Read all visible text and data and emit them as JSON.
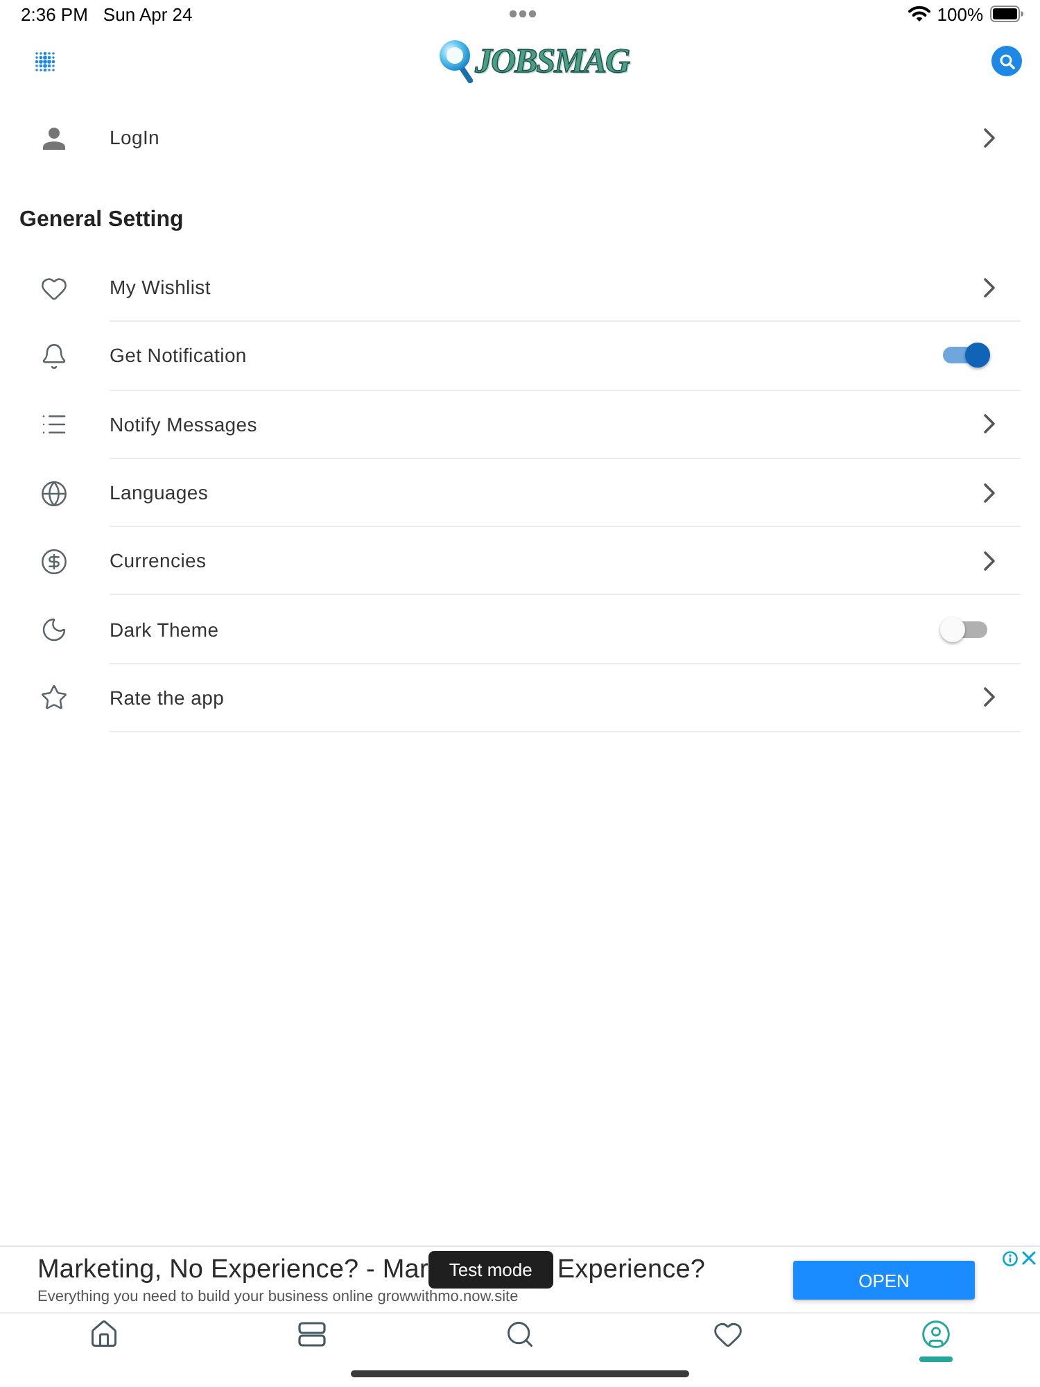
{
  "status_bar": {
    "time": "2:36 PM",
    "date": "Sun Apr 24",
    "battery": "100%"
  },
  "header": {
    "logo": "JOBSMAG"
  },
  "account": {
    "label": "LogIn"
  },
  "section": {
    "title": "General Setting"
  },
  "settings": [
    {
      "kind": "link",
      "label": "My Wishlist"
    },
    {
      "kind": "toggle",
      "label": "Get Notification",
      "on": true
    },
    {
      "kind": "link",
      "label": "Notify Messages"
    },
    {
      "kind": "link",
      "label": "Languages"
    },
    {
      "kind": "link",
      "label": "Currencies"
    },
    {
      "kind": "toggle",
      "label": "Dark Theme",
      "on": false
    },
    {
      "kind": "link",
      "label": "Rate the app"
    }
  ],
  "ad": {
    "headline_start": "Marketing, No Experience? - Mar",
    "headline_end": "Experience?",
    "description": "Everything you need to build your business online growwithmo.now.site",
    "button": "OPEN"
  },
  "toast": {
    "text": "Test mode"
  },
  "tab_bar": [
    {
      "selected": false
    },
    {
      "selected": false
    },
    {
      "selected": false
    },
    {
      "selected": false
    },
    {
      "selected": true
    }
  ]
}
